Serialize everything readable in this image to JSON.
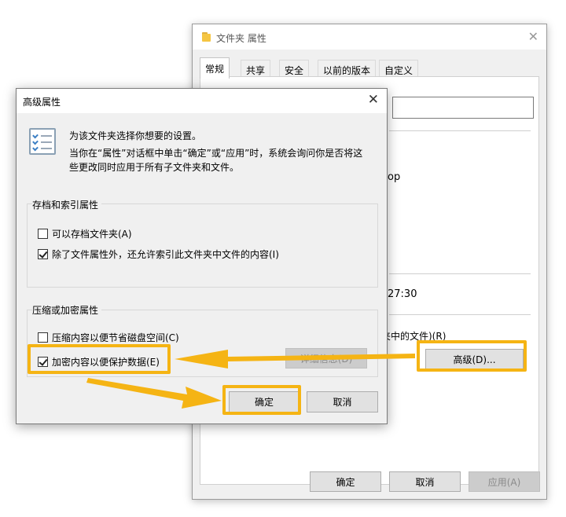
{
  "back_window": {
    "title": "文件夹 属性",
    "close_glyph": "✕",
    "tabs": [
      {
        "label": "常规"
      },
      {
        "label": "共享"
      },
      {
        "label": "安全"
      },
      {
        "label": "以前的版本"
      },
      {
        "label": "自定义"
      }
    ],
    "partial_text_1": "op",
    "partial_text_2": "27:30",
    "partial_text_3": "夹中的文件)(R)",
    "advanced_button": "高级(D)...",
    "ok_button": "确定",
    "cancel_button": "取消",
    "apply_button": "应用(A)"
  },
  "dialog": {
    "title": "高级属性",
    "close_glyph": "✕",
    "desc_line1": "为该文件夹选择你想要的设置。",
    "desc_line2": "当你在“属性”对话框中单击“确定”或“应用”时，系统会询问你是否将这",
    "desc_line3": "些更改同时应用于所有子文件夹和文件。",
    "archive_group": {
      "label": "存档和索引属性",
      "options": [
        {
          "label": "可以存档文件夹(A)",
          "checked": false
        },
        {
          "label": "除了文件属性外，还允许索引此文件夹中文件的内容(I)",
          "checked": true
        }
      ]
    },
    "compress_group": {
      "label": "压缩或加密属性",
      "options": [
        {
          "label": "压缩内容以便节省磁盘空间(C)",
          "checked": false
        },
        {
          "label": "加密内容以便保护数据(E)",
          "checked": true
        }
      ],
      "details_button": "详细信息(D)"
    },
    "ok_button": "确定",
    "cancel_button": "取消"
  },
  "colors": {
    "highlight": "#f5b414",
    "arrow": "#f5b414"
  }
}
